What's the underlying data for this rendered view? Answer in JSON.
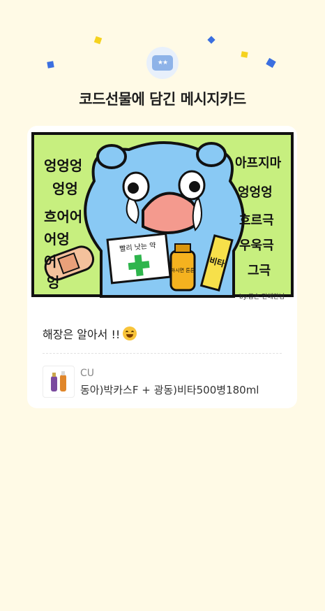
{
  "header": {
    "title": "코드선물에 담긴 메시지카드",
    "badge_icon": "message-card-icon",
    "badge_glyph": "★★"
  },
  "card": {
    "illustration": {
      "left_text": [
        "엉엉엉",
        "엉엉",
        "흐어어",
        "어엉",
        "어",
        "엉"
      ],
      "right_text": [
        "아프지마",
        "엉엉엉",
        "흐르극",
        "우욱극",
        "그극"
      ],
      "note_text": "빨리 낫는 약",
      "bottle_text": "마시면 튼튼",
      "stick_text": "비타",
      "signature": "by.금손 전혜란님"
    },
    "message": "해장은 알아서 !!",
    "message_emoji": "grinning-face-icon",
    "product": {
      "store": "CU",
      "name": "동아)박카스F + 광동)비타500병180ml"
    }
  },
  "colors": {
    "background": "#fffae6",
    "illustration_green": "#c7ef7f",
    "bear_blue": "#89c9f4",
    "confetti_yellow": "#f5d21f",
    "confetti_blue": "#3b6fe0"
  }
}
